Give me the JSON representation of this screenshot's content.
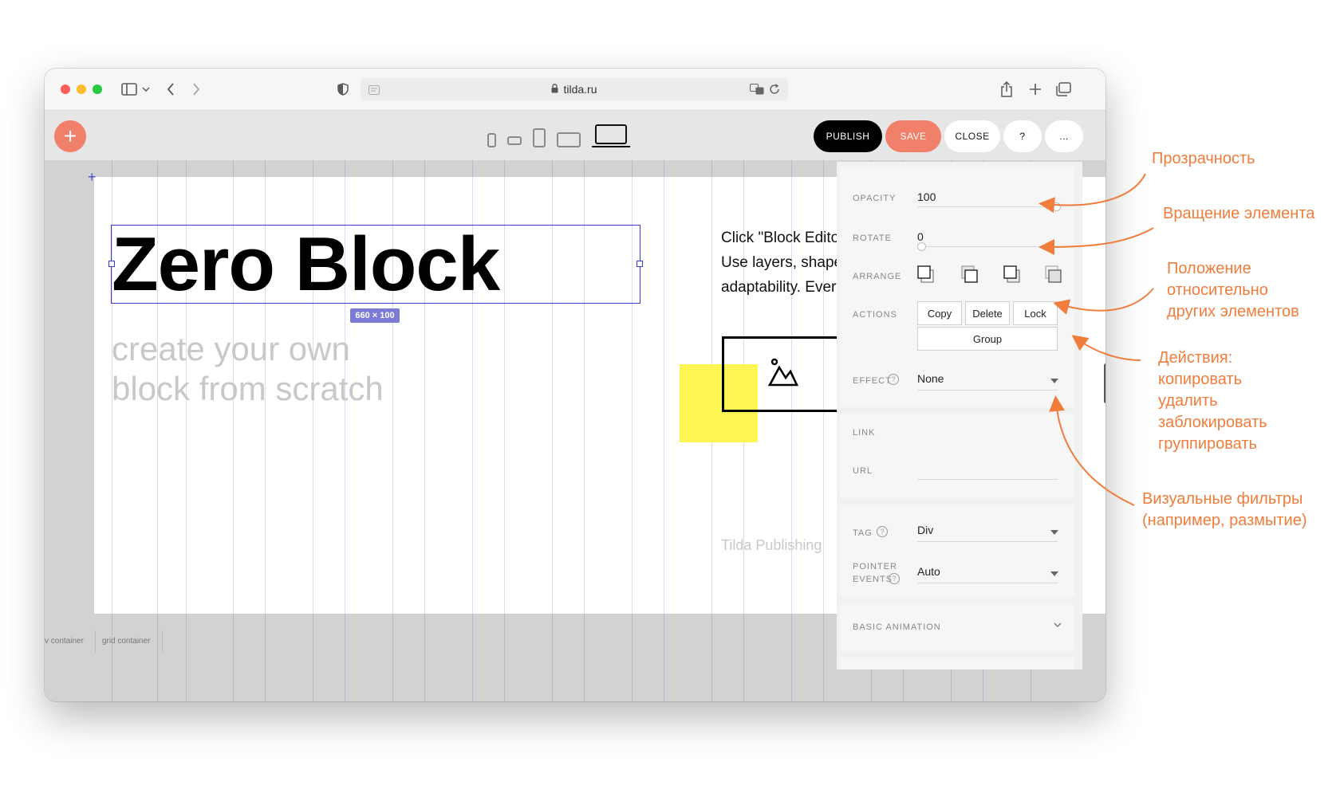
{
  "browser": {
    "url": "tilda.ru",
    "icons": [
      "sidebar-icon",
      "chevron-down-icon",
      "back-icon",
      "forward-icon",
      "shield-icon",
      "lock-icon",
      "translate-icon",
      "reload-icon",
      "share-icon",
      "new-tab-icon",
      "tabs-icon"
    ]
  },
  "toolbar": {
    "add_label": "+",
    "publish_label": "PUBLISH",
    "save_label": "SAVE",
    "close_label": "CLOSE",
    "help_label": "?",
    "more_label": "...",
    "devices": [
      "phone-portrait",
      "phone-landscape",
      "tablet-portrait",
      "tablet-landscape",
      "laptop"
    ],
    "active_device": "laptop",
    "colors": {
      "accent": "#f0806a",
      "publish": "#000000"
    }
  },
  "canvas": {
    "headline": "Zero Block",
    "size_tag": "660 × 100",
    "subtext": [
      "create your own",
      "block from scratch"
    ],
    "body_lines": [
      "Click \"Block Edito",
      "Use layers, shape",
      "adaptability. Every"
    ],
    "brand": "Tilda Publishing",
    "container_labels": [
      "v container",
      "grid container"
    ],
    "colors": {
      "selection": "#3a3ad0",
      "yellow": "#fdf652",
      "gray_text": "#c8c8c8"
    }
  },
  "panel": {
    "opacity": {
      "label": "OPACITY",
      "value": "100",
      "level": 1.0
    },
    "rotate": {
      "label": "ROTATE",
      "value": "0",
      "level": 0.0
    },
    "arrange": {
      "label": "ARRANGE",
      "icons": [
        "bring-front-icon",
        "bring-forward-icon",
        "send-backward-icon",
        "send-back-icon"
      ]
    },
    "actions": {
      "label": "ACTIONS",
      "copy": "Copy",
      "delete": "Delete",
      "lock": "Lock",
      "group": "Group"
    },
    "effect": {
      "label": "EFFECT",
      "value": "None"
    },
    "link": {
      "label": "LINK"
    },
    "url": {
      "label": "URL",
      "value": ""
    },
    "tag": {
      "label": "TAG",
      "value": "Div"
    },
    "pointer_events": {
      "label_line1": "POINTER",
      "label_line2": "EVENTS",
      "value": "Auto"
    },
    "basic_animation": {
      "label": "BASIC ANIMATION"
    }
  },
  "annotations": {
    "opacity": "Прозрачность",
    "rotate": "Вращение элемента",
    "arrange": [
      "Положение",
      "относительно",
      "других элементов"
    ],
    "actions": [
      "Действия:",
      "копировать",
      "удалить",
      "заблокировать",
      "группировать"
    ],
    "effect": [
      "Визуальные фильтры",
      "(например, размытие)"
    ],
    "color": "#f07d3c"
  }
}
